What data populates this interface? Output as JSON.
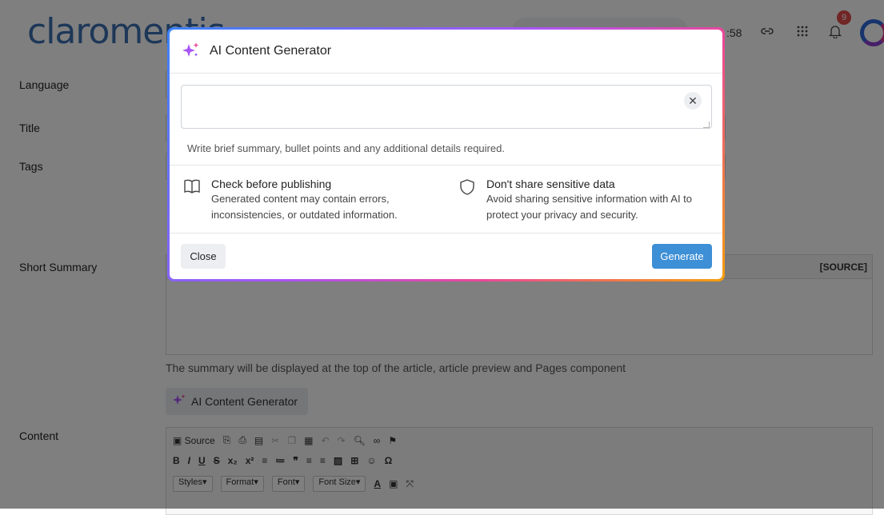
{
  "header": {
    "logo_text": "claromentis",
    "time_text": ":58",
    "notification_count": "9"
  },
  "form": {
    "labels": {
      "language": "Language",
      "title": "Title",
      "tags": "Tags",
      "short_summary": "Short Summary",
      "content": "Content"
    },
    "summary_help": "The summary will be displayed at the top of the article, article preview and Pages component",
    "source_label": "[SOURCE]",
    "ai_button_label": "AI Content Generator",
    "editor_toolbar": {
      "source_label": "Source",
      "styles": "Styles",
      "format": "Format",
      "font": "Font",
      "font_size": "Font Size"
    }
  },
  "modal": {
    "title": "AI Content Generator",
    "prompt_value": "",
    "prompt_help": "Write brief summary, bullet points and any additional details required.",
    "notice_left": {
      "title": "Check before publishing",
      "line1": "Generated content may contain errors,",
      "line2": "inconsistencies, or outdated information."
    },
    "notice_right": {
      "title": "Don't share sensitive data",
      "line1": "Avoid sharing sensitive information with AI to",
      "line2": "protect your privacy and security."
    },
    "close_label": "Close",
    "generate_label": "Generate"
  },
  "colors": {
    "brand_blue": "#3a6fb0",
    "generate_blue": "#3d8fd6",
    "badge_red": "#e34a4a",
    "sparkle_purple": "#a855f7"
  },
  "icons": {
    "modal_sparkle": "sparkle-icon",
    "notice_left": "book-icon",
    "notice_right": "shield-icon",
    "clear": "close-icon"
  }
}
